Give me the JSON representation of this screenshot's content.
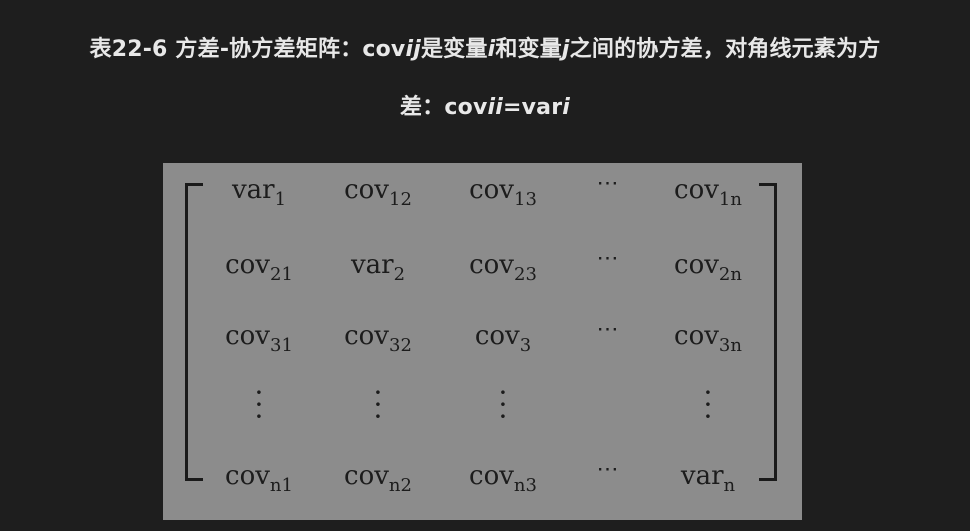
{
  "caption": {
    "line1_prefix": "表22-6 方差-协方差矩阵：cov",
    "line1_ij": "ij",
    "line1_mid1": "是变量",
    "line1_i": "i",
    "line1_mid2": "和变量",
    "line1_j": "j",
    "line1_suffix": "之间的协方差，对角线元素为方",
    "line2_prefix": "差：cov",
    "line2_ii": "ii",
    "line2_mid": "=var",
    "line2_i": "i"
  },
  "matrix": {
    "rows": [
      [
        {
          "base": "var",
          "sub": "1"
        },
        {
          "base": "cov",
          "sub": "12"
        },
        {
          "base": "cov",
          "sub": "13"
        },
        {
          "base": "⋯",
          "sub": ""
        },
        {
          "base": "cov",
          "sub": "1n"
        }
      ],
      [
        {
          "base": "cov",
          "sub": "21"
        },
        {
          "base": "var",
          "sub": "2"
        },
        {
          "base": "cov",
          "sub": "23"
        },
        {
          "base": "⋯",
          "sub": ""
        },
        {
          "base": "cov",
          "sub": "2n"
        }
      ],
      [
        {
          "base": "cov",
          "sub": "31"
        },
        {
          "base": "cov",
          "sub": "32"
        },
        {
          "base": "cov",
          "sub": "3"
        },
        {
          "base": "⋯",
          "sub": ""
        },
        {
          "base": "cov",
          "sub": "3n"
        }
      ],
      [
        {
          "base": "⋮",
          "sub": ""
        },
        {
          "base": "⋮",
          "sub": ""
        },
        {
          "base": "⋮",
          "sub": ""
        },
        {
          "base": "",
          "sub": ""
        },
        {
          "base": "⋮",
          "sub": ""
        }
      ],
      [
        {
          "base": "cov",
          "sub": "n1"
        },
        {
          "base": "cov",
          "sub": "n2"
        },
        {
          "base": "cov",
          "sub": "n3"
        },
        {
          "base": "⋯",
          "sub": ""
        },
        {
          "base": "var",
          "sub": "n"
        }
      ]
    ]
  }
}
